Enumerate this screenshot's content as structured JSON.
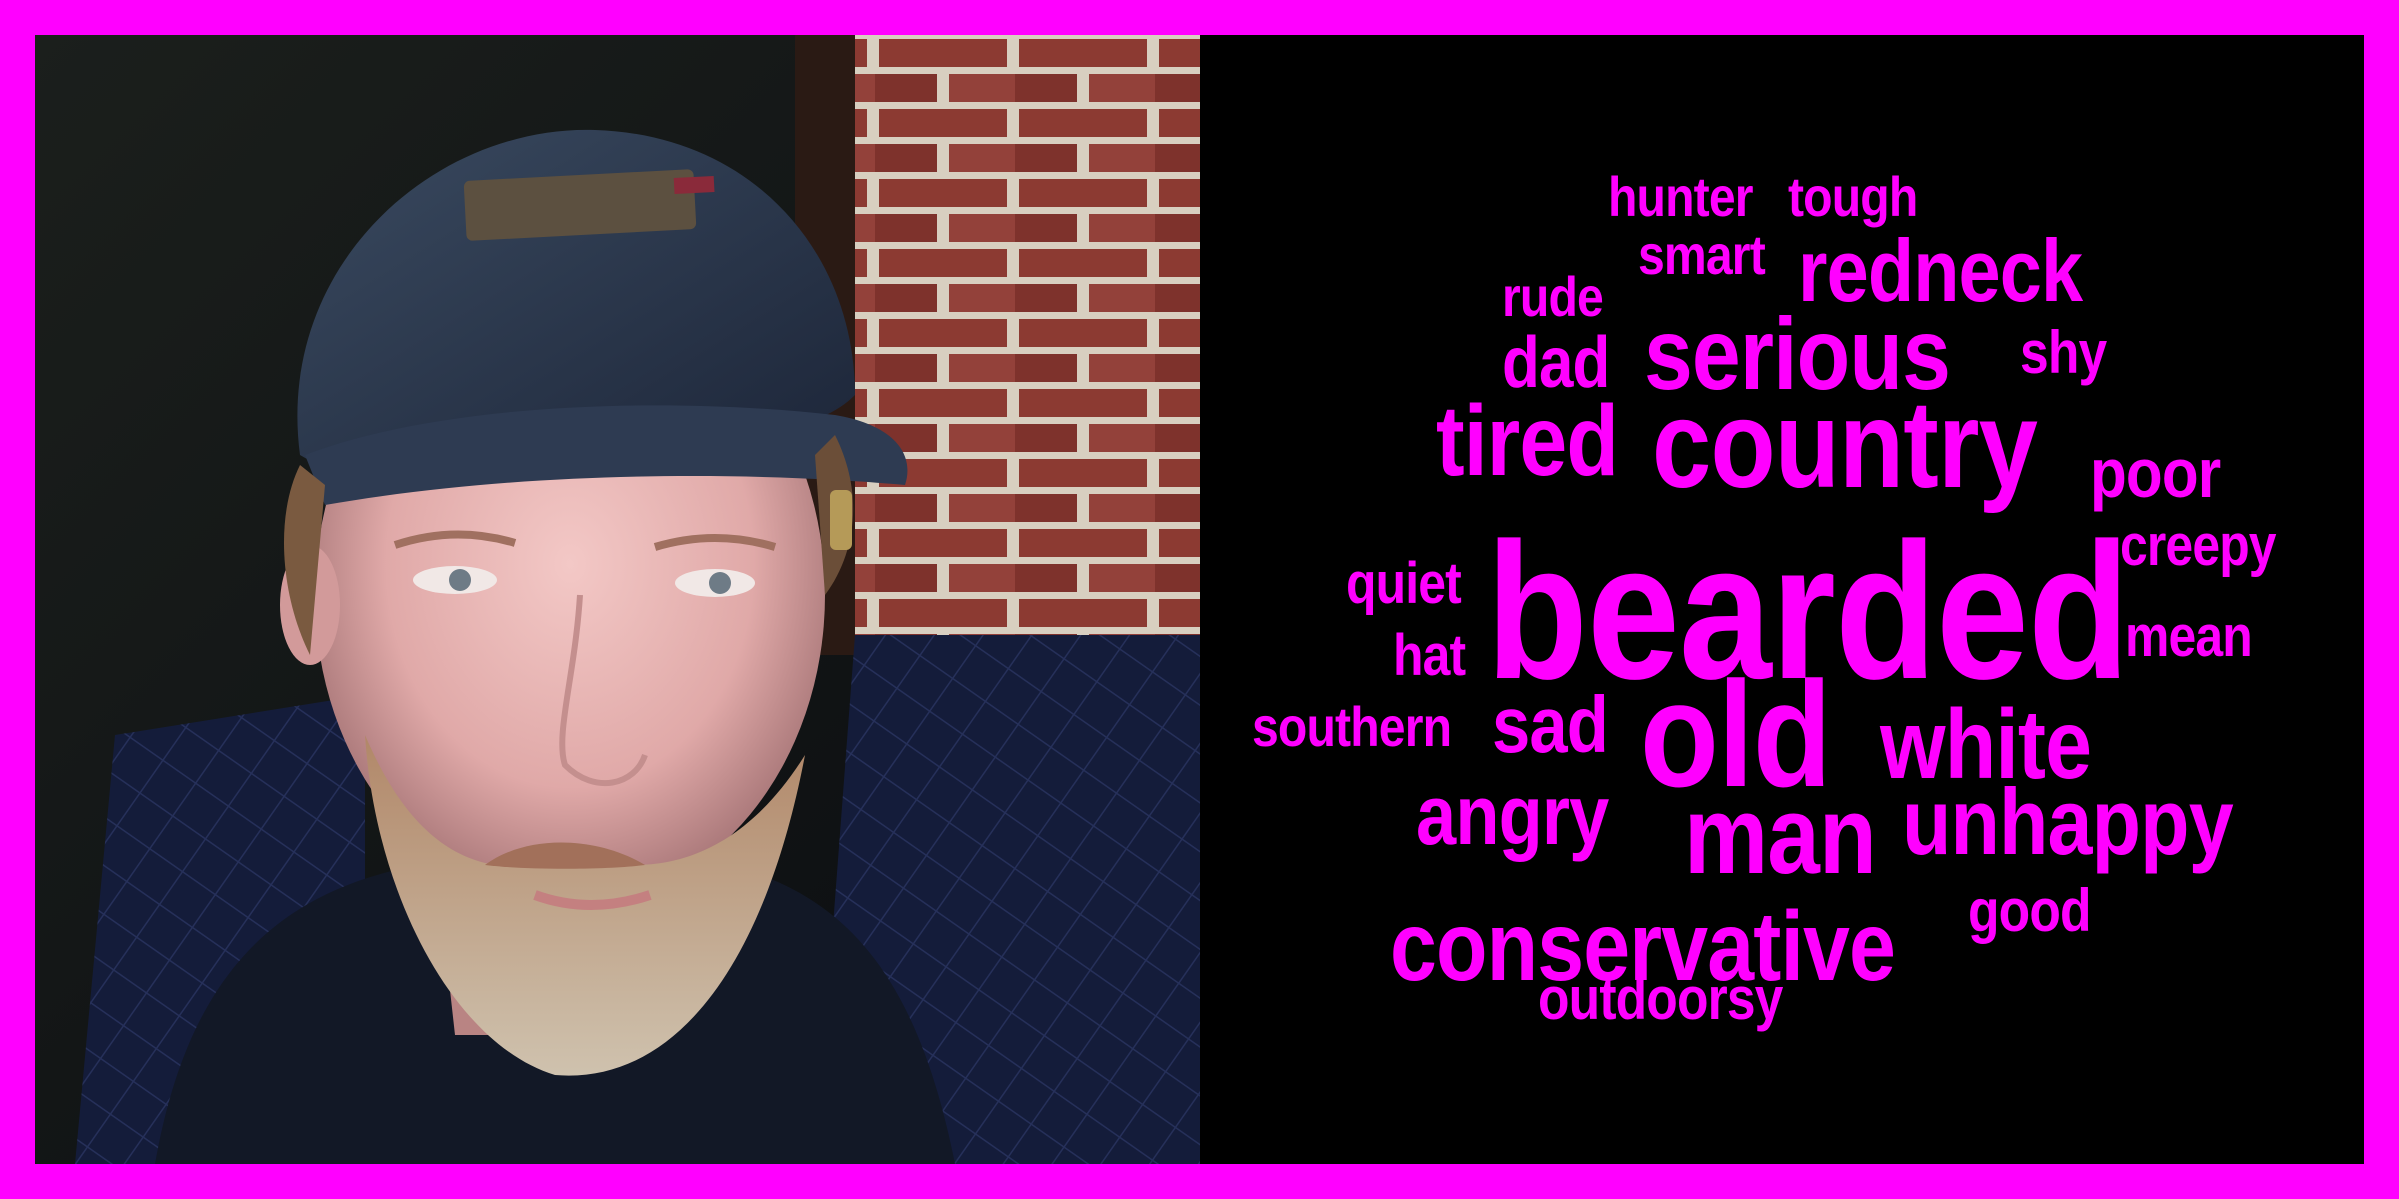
{
  "image": {
    "subject": "Man with beard and cap"
  },
  "wordcloud": {
    "words": [
      {
        "key": "hunter",
        "text": "hunter"
      },
      {
        "key": "tough",
        "text": "tough"
      },
      {
        "key": "smart",
        "text": "smart"
      },
      {
        "key": "redneck",
        "text": "redneck"
      },
      {
        "key": "rude",
        "text": "rude"
      },
      {
        "key": "dad",
        "text": "dad"
      },
      {
        "key": "serious",
        "text": "serious"
      },
      {
        "key": "shy",
        "text": "shy"
      },
      {
        "key": "tired",
        "text": "tired"
      },
      {
        "key": "country",
        "text": "country"
      },
      {
        "key": "poor",
        "text": "poor"
      },
      {
        "key": "creepy",
        "text": "creepy"
      },
      {
        "key": "quiet",
        "text": "quiet"
      },
      {
        "key": "bearded",
        "text": "bearded"
      },
      {
        "key": "hat",
        "text": "hat"
      },
      {
        "key": "mean",
        "text": "mean"
      },
      {
        "key": "southern",
        "text": "southern"
      },
      {
        "key": "sad",
        "text": "sad"
      },
      {
        "key": "old",
        "text": "old"
      },
      {
        "key": "white",
        "text": "white"
      },
      {
        "key": "angry",
        "text": "angry"
      },
      {
        "key": "man",
        "text": "man"
      },
      {
        "key": "unhappy",
        "text": "unhappy"
      },
      {
        "key": "good",
        "text": "good"
      },
      {
        "key": "conservative",
        "text": "conservative"
      },
      {
        "key": "outdoorsy",
        "text": "outdoorsy"
      }
    ]
  },
  "colors": {
    "border": "#ff00ff",
    "word": "#ff00ff",
    "cloud_bg": "#000000"
  }
}
